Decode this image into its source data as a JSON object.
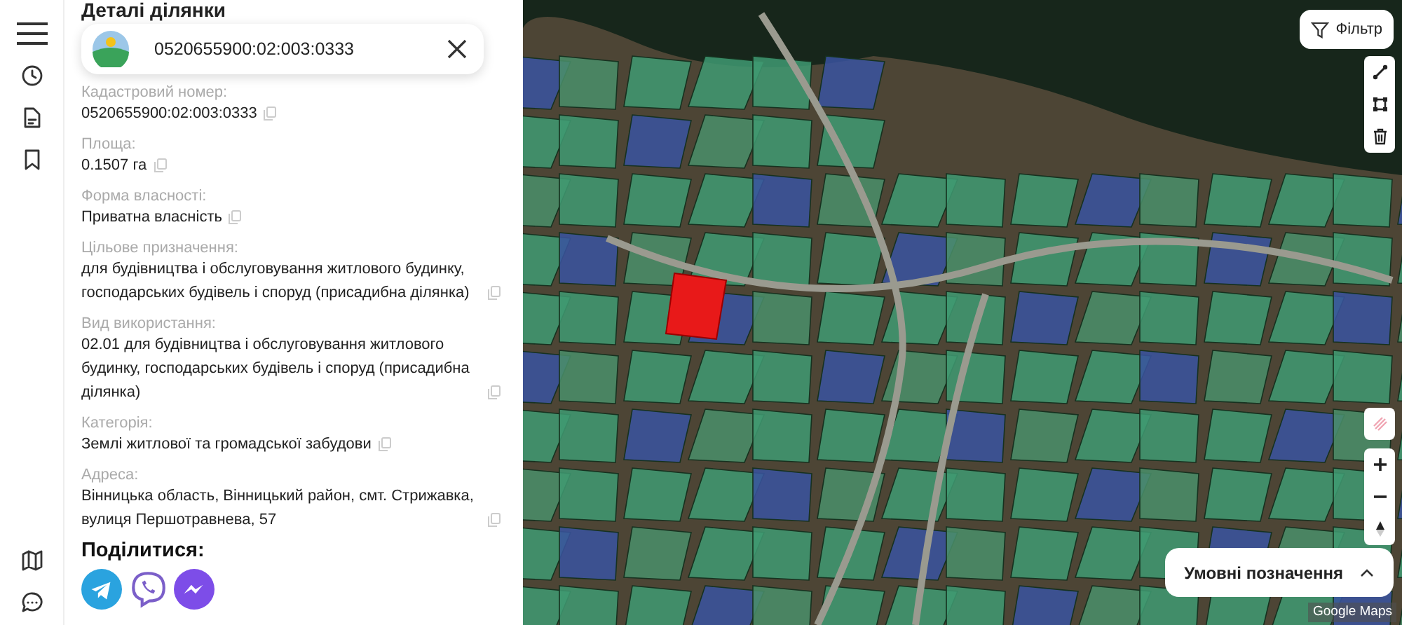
{
  "sidebar": {
    "top": [
      {
        "kind": "history"
      },
      {
        "kind": "document"
      },
      {
        "kind": "bookmark"
      }
    ],
    "bottom": [
      {
        "kind": "map"
      },
      {
        "kind": "chat"
      }
    ]
  },
  "panel": {
    "title": "Деталі ділянки",
    "search": {
      "value": "0520655900:02:003:0333"
    },
    "fields": [
      {
        "label": "Кадастровий номер:",
        "value": "0520655900:02:003:0333"
      },
      {
        "label": "Площа:",
        "value": "0.1507 га"
      },
      {
        "label": "Форма власності:",
        "value": "Приватна власність"
      },
      {
        "label": "Цільове призначення:",
        "value": "для будівництва і обслуговування житлового будинку, господарських будівель і споруд (присадибна ділянка)"
      },
      {
        "label": "Вид використання:",
        "value": "02.01 для будівництва і обслуговування житлового будинку, господарських будівель і споруд (присадибна ділянка)"
      },
      {
        "label": "Категорія:",
        "value": "Землі житлової та громадської забудови"
      },
      {
        "label": "Адреса:",
        "value": "Вінницька область, Вінницький район, смт. Стрижавка, вулиця Першотравнева, 57"
      }
    ],
    "share": {
      "title": "Поділитися:",
      "services": [
        {
          "kind": "telegram"
        },
        {
          "kind": "viber"
        },
        {
          "kind": "messenger"
        }
      ]
    }
  },
  "map": {
    "filter_button": "Фільтр",
    "legend_button": "Умовні позначення",
    "attribution": "Google Maps"
  }
}
